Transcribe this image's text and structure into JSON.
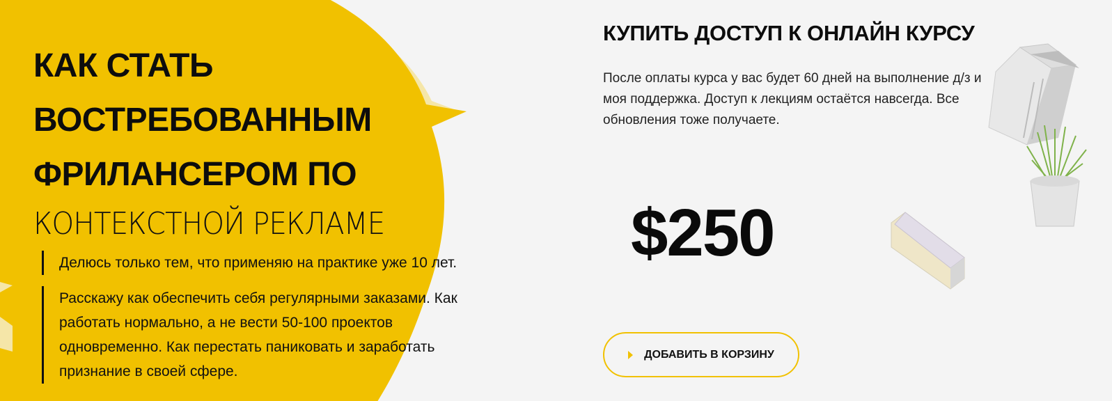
{
  "hero": {
    "title_bold_lines": [
      "КАК СТАТЬ",
      "ВОСТРЕБОВАННЫМ",
      "ФРИЛАНСЕРОМ ПО"
    ],
    "title_light": "КОНТЕКСТНОЙ РЕКЛАМЕ",
    "bullets": [
      "Делюсь только тем, что применяю на практике уже 10 лет.",
      "Расскажу как обеспечить себя регулярными заказами. Как работать нормально, а не вести 50-100 проектов одновременно. Как перестать паниковать и заработать признание в своей сфере."
    ]
  },
  "purchase": {
    "title": "КУПИТЬ ДОСТУП К ОНЛАЙН КУРСУ",
    "description": "После оплаты курса у вас будет 60 дней на выполнение д/з и моя поддержка. Доступ к лекциям остаётся навсегда. Все обновления тоже получаете.",
    "price": "$250",
    "add_to_cart_label": "ДОБАВИТЬ В КОРЗИНУ",
    "add_to_cart_icon": "play-triangle-icon"
  },
  "colors": {
    "accent_yellow": "#f1c100",
    "light_yellow": "#f5e6a8",
    "background": "#f4f4f4",
    "text": "#111111"
  }
}
